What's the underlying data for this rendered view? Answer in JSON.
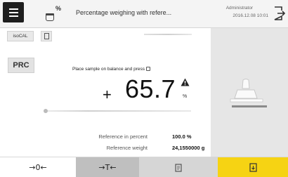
{
  "header": {
    "title": "Percentage weighing with refere...",
    "method_symbol": "%",
    "user": "Administrator",
    "datetime": "2016.12.08   10:01",
    "menu_icon": "hamburger-menu-icon",
    "exit_icon": "exit-icon"
  },
  "toolbar": {
    "iso_label": "isoCAL",
    "doc_icon": "document-icon"
  },
  "prc_label": "PRC",
  "instruction": "Place sample on balance and press",
  "weight": {
    "sign": "+",
    "value": "65.7",
    "unit": "%"
  },
  "reference": {
    "percent_label": "Reference in percent",
    "percent_value": "100.0 %",
    "weight_label": "Reference weight",
    "weight_value": "24,1550000 g"
  },
  "bottom": {
    "zero_label": "→0←",
    "tare_label": "→T←",
    "doc_icon": "document-icon",
    "ok_icon": "transfer-icon"
  },
  "colors": {
    "accent": "#f6d313",
    "menu": "#1e1e1e"
  }
}
